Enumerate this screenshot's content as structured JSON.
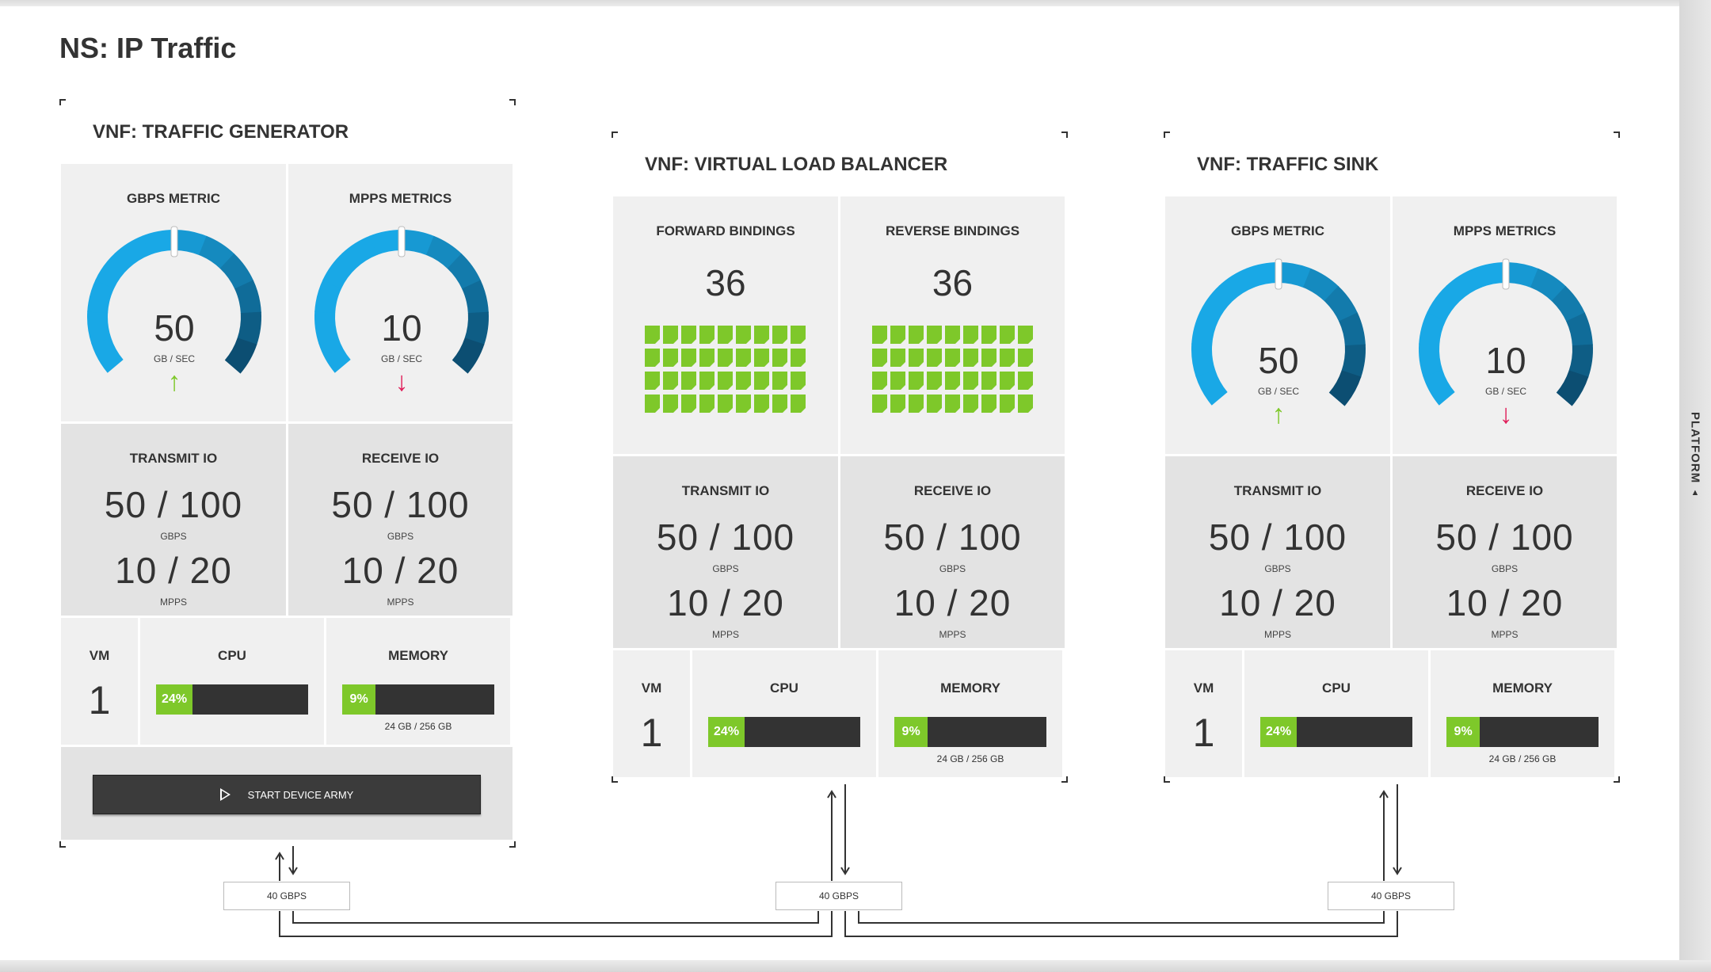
{
  "page": {
    "title": "NS: IP Traffic",
    "platform_tab": "PLATFORM"
  },
  "colors": {
    "accent_green": "#7ec82a",
    "down_red": "#e01e5a",
    "gauge_blue_light": "#19a8e6",
    "gauge_blue_dark": "#0c4e72"
  },
  "generator": {
    "title": "VNF: TRAFFIC GENERATOR",
    "gbps": {
      "label": "GBPS METRIC",
      "value": "50",
      "unit": "GB / SEC",
      "trend": "up"
    },
    "mpps": {
      "label": "MPPS METRICS",
      "value": "10",
      "unit": "GB / SEC",
      "trend": "down"
    },
    "transmit": {
      "label": "TRANSMIT IO",
      "gbps": "50 / 100",
      "gbps_unit": "GBPS",
      "mpps": "10 / 20",
      "mpps_unit": "MPPS"
    },
    "receive": {
      "label": "RECEIVE IO",
      "gbps": "50 / 100",
      "gbps_unit": "GBPS",
      "mpps": "10 / 20",
      "mpps_unit": "MPPS"
    },
    "vm": {
      "label": "VM",
      "value": "1"
    },
    "cpu": {
      "label": "CPU",
      "percent": "24%",
      "fraction": 0.24
    },
    "memory": {
      "label": "MEMORY",
      "percent": "9%",
      "fraction": 0.09,
      "detail": "24 GB / 256 GB"
    },
    "start_button": "START DEVICE ARMY",
    "link": "40 GBPS"
  },
  "balancer": {
    "title": "VNF: VIRTUAL LOAD BALANCER",
    "forward": {
      "label": "FORWARD BINDINGS",
      "value": "36"
    },
    "reverse": {
      "label": "REVERSE BINDINGS",
      "value": "36"
    },
    "transmit": {
      "label": "TRANSMIT IO",
      "gbps": "50 / 100",
      "gbps_unit": "GBPS",
      "mpps": "10 / 20",
      "mpps_unit": "MPPS"
    },
    "receive": {
      "label": "RECEIVE IO",
      "gbps": "50 / 100",
      "gbps_unit": "GBPS",
      "mpps": "10 / 20",
      "mpps_unit": "MPPS"
    },
    "vm": {
      "label": "VM",
      "value": "1"
    },
    "cpu": {
      "label": "CPU",
      "percent": "24%",
      "fraction": 0.24
    },
    "memory": {
      "label": "MEMORY",
      "percent": "9%",
      "fraction": 0.09,
      "detail": "24 GB / 256 GB"
    },
    "link": "40 GBPS"
  },
  "sink": {
    "title": "VNF: TRAFFIC SINK",
    "gbps": {
      "label": "GBPS METRIC",
      "value": "50",
      "unit": "GB / SEC",
      "trend": "up"
    },
    "mpps": {
      "label": "MPPS METRICS",
      "value": "10",
      "unit": "GB / SEC",
      "trend": "down"
    },
    "transmit": {
      "label": "TRANSMIT IO",
      "gbps": "50 / 100",
      "gbps_unit": "GBPS",
      "mpps": "10 / 20",
      "mpps_unit": "MPPS"
    },
    "receive": {
      "label": "RECEIVE IO",
      "gbps": "50 / 100",
      "gbps_unit": "GBPS",
      "mpps": "10 / 20",
      "mpps_unit": "MPPS"
    },
    "vm": {
      "label": "VM",
      "value": "1"
    },
    "cpu": {
      "label": "CPU",
      "percent": "24%",
      "fraction": 0.24
    },
    "memory": {
      "label": "MEMORY",
      "percent": "9%",
      "fraction": 0.09,
      "detail": "24 GB / 256 GB"
    },
    "link": "40 GBPS"
  }
}
